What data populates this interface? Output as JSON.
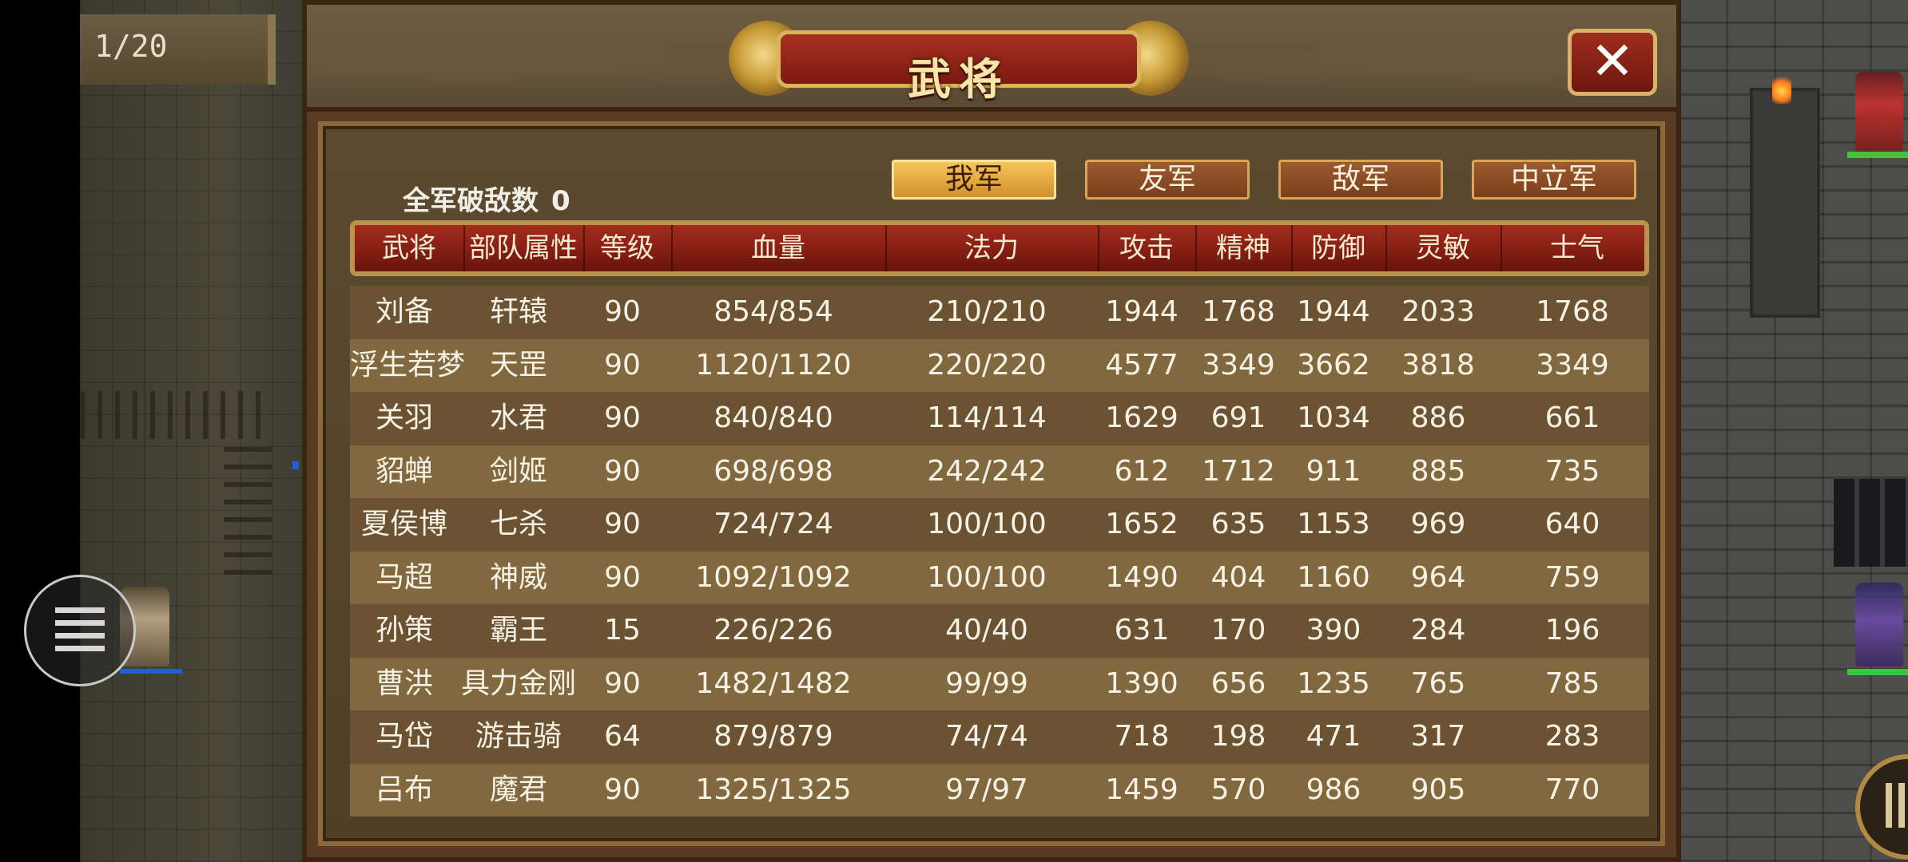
{
  "turn_counter": "1/20",
  "dialog": {
    "title": "武将",
    "close_icon": "close-x-icon"
  },
  "kill_count": {
    "label": "全军破敌数",
    "value": "0"
  },
  "faction_tabs": [
    {
      "label": "我军",
      "active": true
    },
    {
      "label": "友军",
      "active": false
    },
    {
      "label": "敌军",
      "active": false
    },
    {
      "label": "中立军",
      "active": false
    }
  ],
  "table": {
    "headers": [
      "武将",
      "部队属性",
      "等级",
      "血量",
      "法力",
      "攻击",
      "精神",
      "防御",
      "灵敏",
      "士气"
    ],
    "rows": [
      [
        "刘备",
        "轩辕",
        "90",
        "854/854",
        "210/210",
        "1944",
        "1768",
        "1944",
        "2033",
        "1768"
      ],
      [
        "浮生若梦",
        "天罡",
        "90",
        "1120/1120",
        "220/220",
        "4577",
        "3349",
        "3662",
        "3818",
        "3349"
      ],
      [
        "关羽",
        "水君",
        "90",
        "840/840",
        "114/114",
        "1629",
        "691",
        "1034",
        "886",
        "661"
      ],
      [
        "貂蝉",
        "剑姬",
        "90",
        "698/698",
        "242/242",
        "612",
        "1712",
        "911",
        "885",
        "735"
      ],
      [
        "夏侯博",
        "七杀",
        "90",
        "724/724",
        "100/100",
        "1652",
        "635",
        "1153",
        "969",
        "640"
      ],
      [
        "马超",
        "神威",
        "90",
        "1092/1092",
        "100/100",
        "1490",
        "404",
        "1160",
        "964",
        "759"
      ],
      [
        "孙策",
        "霸王",
        "15",
        "226/226",
        "40/40",
        "631",
        "170",
        "390",
        "284",
        "196"
      ],
      [
        "曹洪",
        "具力金刚",
        "90",
        "1482/1482",
        "99/99",
        "1390",
        "656",
        "1235",
        "765",
        "785"
      ],
      [
        "马岱",
        "游击骑",
        "64",
        "879/879",
        "74/74",
        "718",
        "198",
        "471",
        "317",
        "283"
      ],
      [
        "吕布",
        "魔君",
        "90",
        "1325/1325",
        "97/97",
        "1459",
        "570",
        "986",
        "905",
        "770"
      ]
    ]
  },
  "side_controls": {
    "menu_icon": "menu-lines-icon",
    "right_button_icon": "bars-icon"
  }
}
